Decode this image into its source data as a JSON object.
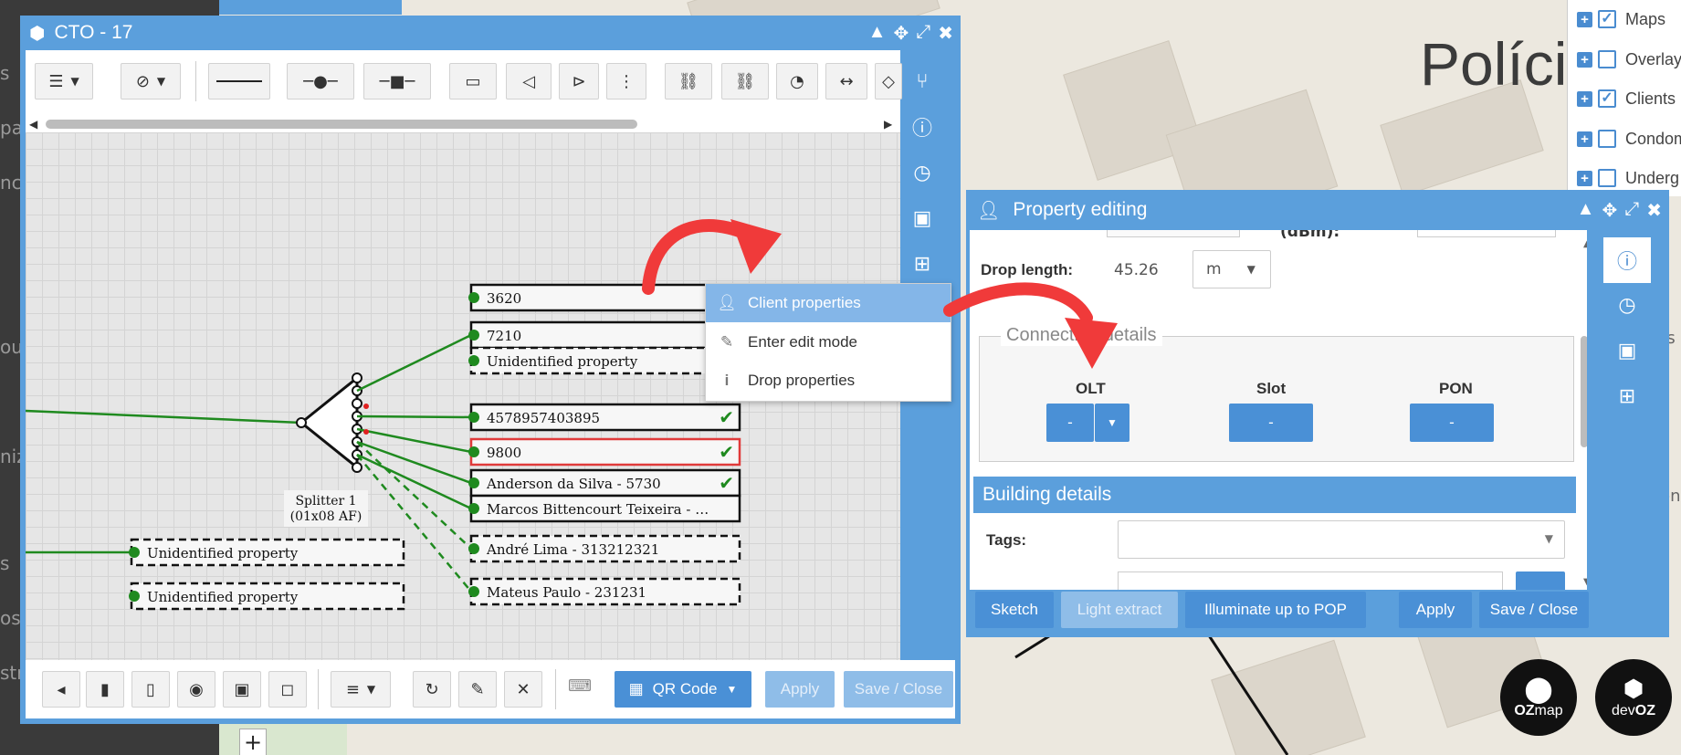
{
  "colors": {
    "accent": "#5b9fdc",
    "red_arrow": "#f03a3a",
    "link_green": "#1f8a1f"
  },
  "left_bar": {
    "snippets": [
      "s",
      "pa",
      "nci",
      "ou",
      "niz",
      "s",
      "os",
      "str"
    ]
  },
  "map": {
    "label": "Políci",
    "zoom_control": "+"
  },
  "layers": [
    {
      "label": "Maps",
      "checked": true
    },
    {
      "label": "Overlays",
      "checked": false
    },
    {
      "label": "Clients",
      "checked": true
    },
    {
      "label": "Condom",
      "checked": false
    },
    {
      "label": "Underg",
      "checked": false
    },
    {
      "label": "s",
      "checked": false
    }
  ],
  "right_map_snippets": [
    "rs",
    "s",
    "s",
    "en"
  ],
  "cto_window": {
    "title": "CTO - 17",
    "icon": "cube-icon",
    "controls": [
      "collapse-icon",
      "move-icon",
      "expand-icon",
      "close-icon"
    ],
    "side_tabs": [
      "branch-icon",
      "info-icon",
      "clock-icon",
      "image-icon",
      "toolbox-icon"
    ],
    "diagram": {
      "splitter": {
        "name": "Splitter 1",
        "spec": "(01x08 AF)"
      },
      "ports": [
        {
          "label": "3620",
          "style": "solid",
          "checked": true
        },
        {
          "label": "7210",
          "style": "solid",
          "checked": false
        },
        {
          "label": "Unidentified property",
          "style": "dashed",
          "checked": false
        },
        {
          "label": "4578957403895",
          "style": "solid",
          "checked": true
        },
        {
          "label": "9800",
          "style": "red",
          "checked": true
        },
        {
          "label": "Anderson da Silva - 5730",
          "style": "solid",
          "checked": true
        },
        {
          "label": "Marcos Bittencourt Teixeira - …",
          "style": "solid",
          "checked": false
        },
        {
          "label": "André Lima - 313212321",
          "style": "dashed",
          "checked": false
        },
        {
          "label": "Mateus Paulo - 231231",
          "style": "dashed",
          "checked": false
        }
      ],
      "left_ports": [
        {
          "label": "Unidentified property"
        },
        {
          "label": "Unidentified property"
        }
      ]
    },
    "footer": {
      "qr_label": "QR Code",
      "apply_label": "Apply",
      "save_label": "Save / Close"
    }
  },
  "context_menu": {
    "items": [
      {
        "label": "Client properties",
        "icon": "user-icon",
        "active": true
      },
      {
        "label": "Enter edit mode",
        "icon": "pencil-icon",
        "active": false
      },
      {
        "label": "Drop properties",
        "icon": "info-icon",
        "active": false
      }
    ]
  },
  "property_window": {
    "title": "Property editing",
    "cutoff_label": "(dBm):",
    "drop_length": {
      "label": "Drop length:",
      "value": "45.26",
      "unit": "m"
    },
    "connection": {
      "legend": "Connection details",
      "olt": {
        "label": "OLT",
        "value": "-"
      },
      "slot": {
        "label": "Slot",
        "value": "-"
      },
      "pon": {
        "label": "PON",
        "value": "-"
      }
    },
    "building": {
      "header": "Building details",
      "tags_label": "Tags:"
    },
    "side_tabs": [
      "info-icon",
      "clock-icon",
      "image-icon",
      "toolbox-icon"
    ],
    "buttons": {
      "sketch": "Sketch",
      "light_extract": "Light extract",
      "illuminate": "Illuminate up to POP",
      "apply": "Apply",
      "save": "Save / Close"
    }
  },
  "logos": [
    {
      "text_a": "OZ",
      "text_b": "map"
    },
    {
      "text_a": "dev",
      "text_b": "OZ"
    }
  ]
}
